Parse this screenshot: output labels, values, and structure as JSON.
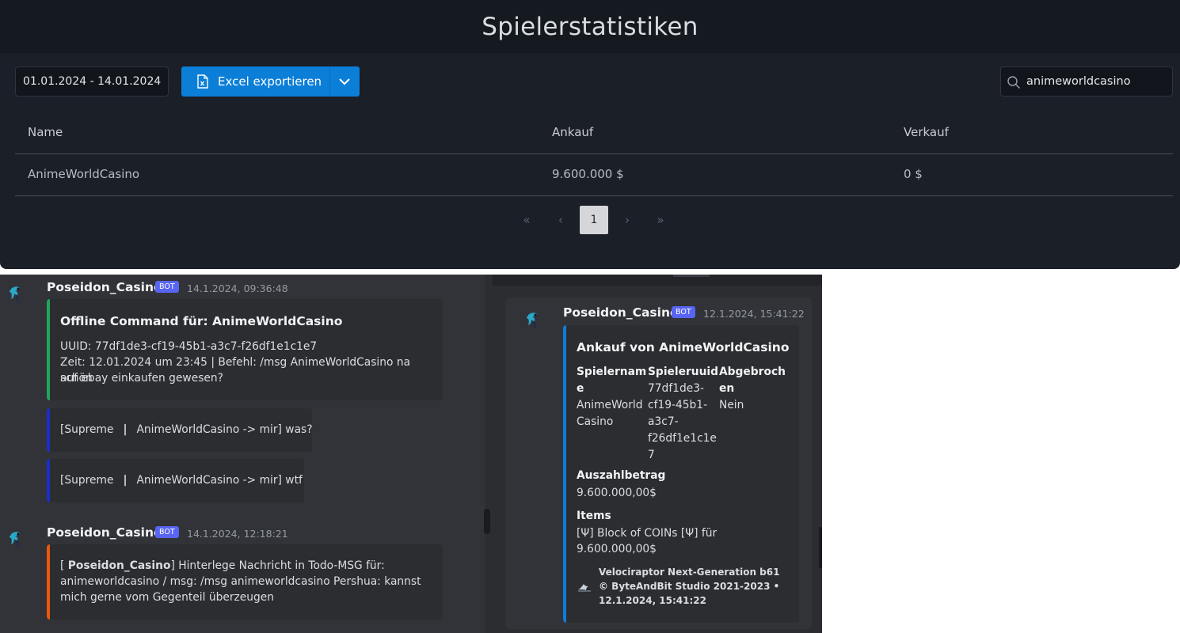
{
  "dashboard": {
    "title": "Spielerstatistiken",
    "date_range": "01.01.2024 - 14.01.2024",
    "export_label": "Excel exportieren",
    "search_value": "animeworldcasino",
    "table": {
      "headers": [
        "Name",
        "Ankauf",
        "Verkauf"
      ],
      "rows": [
        [
          "AnimeWorldCasino",
          "9.600.000 $",
          "0 $"
        ]
      ]
    },
    "pagination": {
      "first": "«",
      "prev": "‹",
      "current": "1",
      "next": "›",
      "last": "»"
    }
  },
  "discord_left": {
    "messages": [
      {
        "author": "Poseidon_Casino",
        "badge": "BOT",
        "timestamp": "14.1.2024, 09:36:48",
        "embed": {
          "title": "Offline Command für: AnimeWorldCasino",
          "line1": "UUID: 77df1de3-cf19-45b1-a3c7-f26df1e1c1e7",
          "line2": "Zeit: 12.01.2024 um 23:45 | Befehl: /msg AnimeWorldCasino na schön",
          "line3": "auf ebay einkaufen gewesen?",
          "color": "#23a559"
        },
        "replies": [
          {
            "prefix": "[Supreme",
            "sep": "|",
            "suffix": "AnimeWorldCasino -> mir] was?",
            "color": "#1b2fc8"
          },
          {
            "prefix": "[Supreme",
            "sep": "|",
            "suffix": "AnimeWorldCasino -> mir] wtf",
            "color": "#1b2fc8"
          }
        ]
      },
      {
        "author": "Poseidon_Casino",
        "badge": "BOT",
        "timestamp": "14.1.2024, 12:18:21",
        "embed": {
          "open_bracket": "[ ",
          "bold_name": "Poseidon_Casino",
          "line1_rest": "] Hinterlege Nachricht in Todo-MSG für:",
          "line2": "animeworldcasino / msg: /msg animeworldcasino Pershua: kannst",
          "line3": "mich gerne vom Gegenteil überzeugen",
          "color": "#e8590c"
        }
      }
    ]
  },
  "discord_right": {
    "author": "Poseidon_Casino",
    "badge": "BOT",
    "timestamp": "12.1.2024, 15:41:22",
    "embed": {
      "title": "Ankauf von AnimeWorldCasino",
      "color": "#0b7ed8",
      "fields": {
        "spielername_label_1": "Spielernam",
        "spielername_label_2": "e",
        "spielername_value_1": "AnimeWorld",
        "spielername_value_2": "Casino",
        "uuid_label": "Spieleruuid",
        "uuid_value_1": "77df1de3-",
        "uuid_value_2": "cf19-45b1-",
        "uuid_value_3": "a3c7-",
        "uuid_value_4": "f26df1e1c1e",
        "uuid_value_5": "7",
        "abgebrochen_label_1": "Abgebroch",
        "abgebrochen_label_2": "en",
        "abgebrochen_value": "Nein",
        "auszahl_label": "Auszahlbetrag",
        "auszahl_value": "9.600.000,00$",
        "items_label": "Items",
        "items_value_1": "[Ψ] Block of COINs [Ψ] für",
        "items_value_2": "9.600.000,00$"
      },
      "footer_1": "Velociraptor Next-Generation b61",
      "footer_2": "© ByteAndBit Studio 2021-2023 •",
      "footer_3": "12.1.2024, 15:41:22"
    }
  },
  "colors": {
    "accent_blue": "#0b7ed8",
    "bot_badge": "#5865f2"
  }
}
